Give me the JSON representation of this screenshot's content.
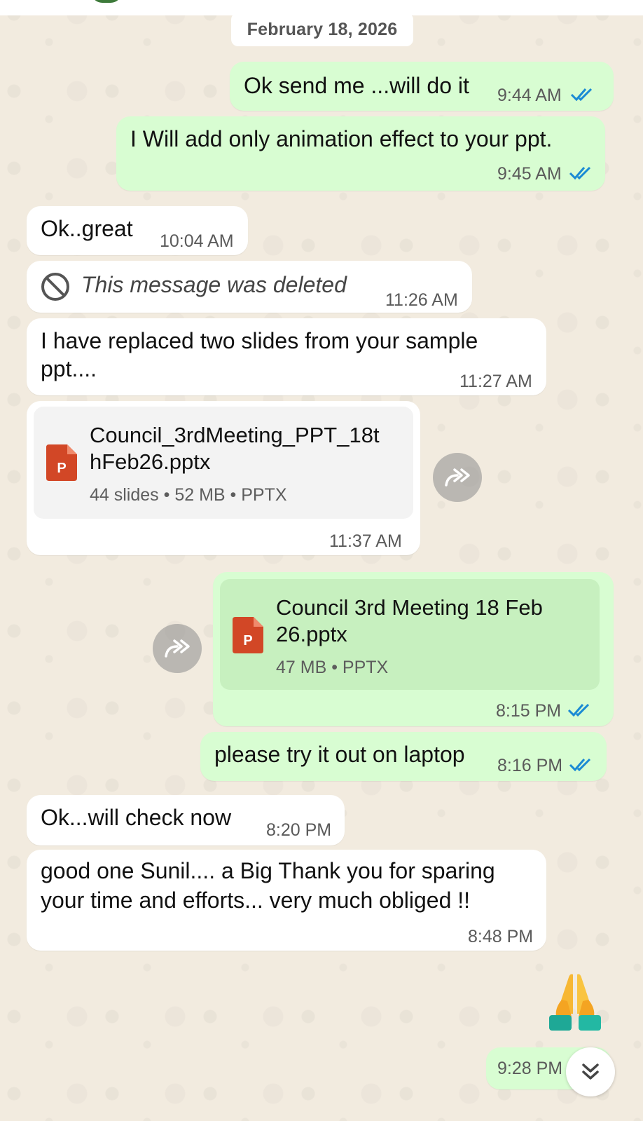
{
  "date_divider": "February 18, 2026",
  "colors": {
    "outgoing_bubble": "#d8fdd2",
    "incoming_bubble": "#ffffff",
    "read_ticks": "#1a8ad4",
    "ppt_icon": "#d24726"
  },
  "messages": [
    {
      "direction": "outgoing",
      "text": "Ok send me ...will do it",
      "time": "9:44 AM",
      "status": "read"
    },
    {
      "direction": "outgoing",
      "text": "I Will add only animation effect to your ppt.",
      "time": "9:45 AM",
      "status": "read"
    },
    {
      "direction": "incoming",
      "text": "Ok..great",
      "time": "10:04 AM"
    },
    {
      "direction": "incoming",
      "text": "This message was deleted",
      "time": "11:26 AM",
      "icon": "blocked-icon",
      "deleted": true
    },
    {
      "direction": "incoming",
      "text_lines": [
        "I have replaced two slides from your sample",
        "ppt...."
      ],
      "time": "11:27 AM"
    },
    {
      "direction": "incoming",
      "document": {
        "name_lines": [
          "Council_3rdMeeting_PPT_18t",
          "hFeb26.pptx"
        ],
        "meta": "44 slides • 52 MB • PPTX",
        "icon": "powerpoint-icon",
        "icon_letter": "P"
      },
      "time": "11:37 AM"
    },
    {
      "direction": "outgoing",
      "document": {
        "name_lines": [
          "Council 3rd Meeting 18 Feb",
          "26.pptx"
        ],
        "meta": "47 MB • PPTX",
        "icon": "powerpoint-icon",
        "icon_letter": "P"
      },
      "time": "8:15 PM",
      "status": "read"
    },
    {
      "direction": "outgoing",
      "text": "please try it out on laptop",
      "time": "8:16 PM",
      "status": "read"
    },
    {
      "direction": "incoming",
      "text": "Ok...will check now",
      "time": "8:20 PM"
    },
    {
      "direction": "incoming",
      "text_lines": [
        "good one Sunil.... a Big Thank you for sparing",
        "your time and efforts... very much obliged !!"
      ],
      "time": "8:48 PM"
    },
    {
      "direction": "outgoing",
      "emoji": "folded-hands-emoji",
      "time": "9:28 PM",
      "status": "read"
    }
  ],
  "icons": {
    "forward": "forward-icon",
    "scroll_down": "double-chevron-down-icon"
  }
}
